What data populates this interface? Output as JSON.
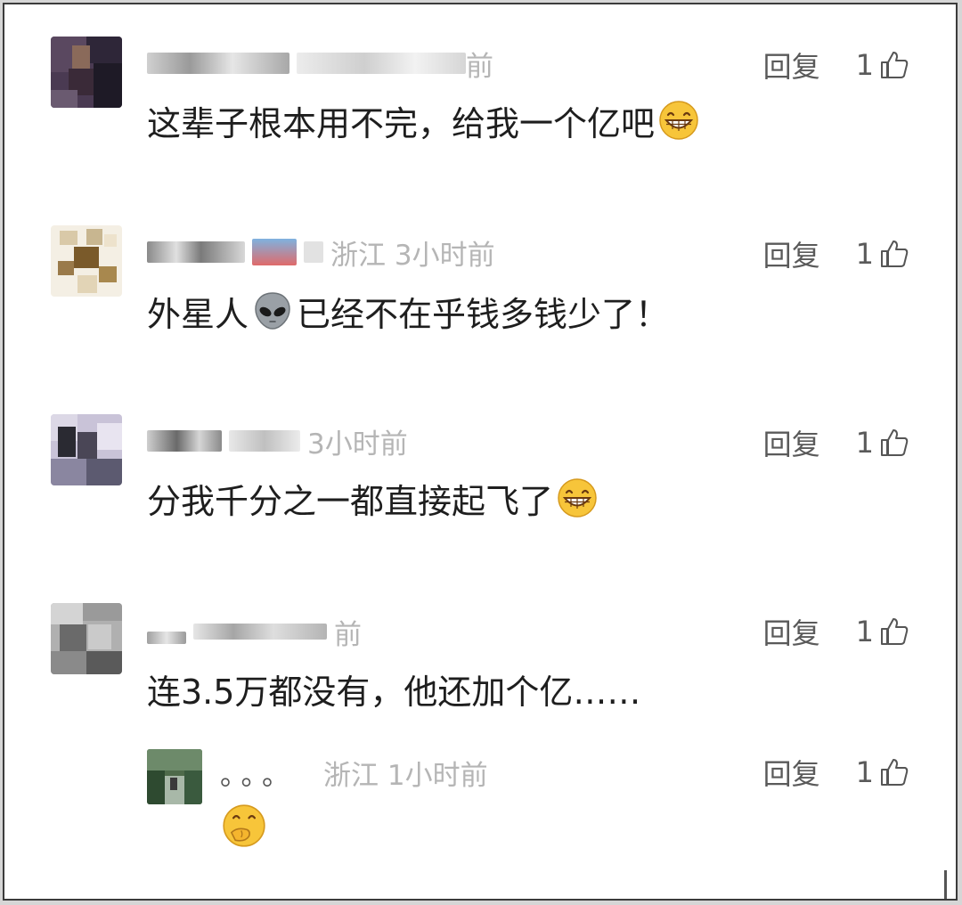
{
  "reply_label": "回复",
  "comments": [
    {
      "meta_text": "前",
      "text": "这辈子根本用不完，给我一个亿吧",
      "emoji": "grin-emoji",
      "likes": "1"
    },
    {
      "meta_text": "浙江 3小时前",
      "text_a": "外星人",
      "emoji": "alien-emoji",
      "text_b": "已经不在乎钱多钱少了！",
      "likes": "1"
    },
    {
      "meta_text": "3小时前",
      "text": "分我千分之一都直接起飞了",
      "emoji": "grin-emoji",
      "likes": "1"
    },
    {
      "meta_text": "前",
      "text": "连3.5万都没有，他还加个亿……",
      "likes": "1"
    },
    {
      "username": "。。。",
      "meta_text": "浙江 1小时前",
      "emoji": "thinking-hand-emoji",
      "likes": "1"
    }
  ],
  "colors": {
    "meta": "#b5b5b5",
    "text": "#1e1e1e",
    "action": "#5a5a5a",
    "emoji_yellow": "#f7c53a"
  }
}
